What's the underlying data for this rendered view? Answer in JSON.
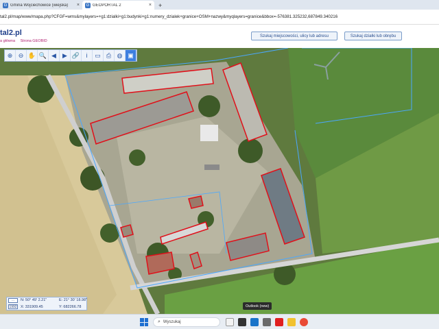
{
  "browser": {
    "tabs": [
      {
        "label": "Gmina Wojciechowice (wiejska)",
        "active": false
      },
      {
        "label": "GEOPORTAL 2",
        "active": true
      }
    ],
    "new_tab": "+",
    "close": "×",
    "url": "tal2.pl/map/www/mapa.php?CFGF=wms&mylayers=+g1:dzialki+g1:budynki+g1:numery_dzialek+granice+OSM+nazwy&myqlayers=granice&bbox=-576381.325232,687849.340216"
  },
  "site": {
    "logo": "tal2.pl",
    "links": [
      "a główna",
      "Strona GEOBID"
    ],
    "search_place_button": "Szukaj miejscowości, ulicy lub adresu",
    "search_parcel_button": "Szukaj działki lub obrębu"
  },
  "toolbar": {
    "tools": [
      "zoom-in-icon",
      "zoom-out-icon",
      "pan-hand-icon",
      "zoom-region-icon",
      "arrow-left-icon",
      "arrow-right-icon",
      "link-icon",
      "info-icon",
      "measure-icon",
      "print-icon",
      "globe-icon",
      "camera-icon"
    ],
    "glyphs": [
      "⊕",
      "⊖",
      "✋",
      "🔍",
      "◀",
      "▶",
      "🔗",
      "i",
      "▭",
      "⎙",
      "◍",
      "▣"
    ]
  },
  "coords": {
    "tag1": "⋯",
    "tag2": "1992",
    "n": "N: 50° 49' 2.21\"",
    "e": "E: 21° 30' 18.98\"",
    "x": "X: 331909.45",
    "y": "Y: 682266.78"
  },
  "tooltip": "Outlook (new)",
  "taskbar": {
    "search_placeholder": "Wyszukaj"
  },
  "colors": {
    "parcel_line": "#4aa8ff",
    "building_outline": "#e0101a",
    "accent": "#2a4f8f"
  }
}
